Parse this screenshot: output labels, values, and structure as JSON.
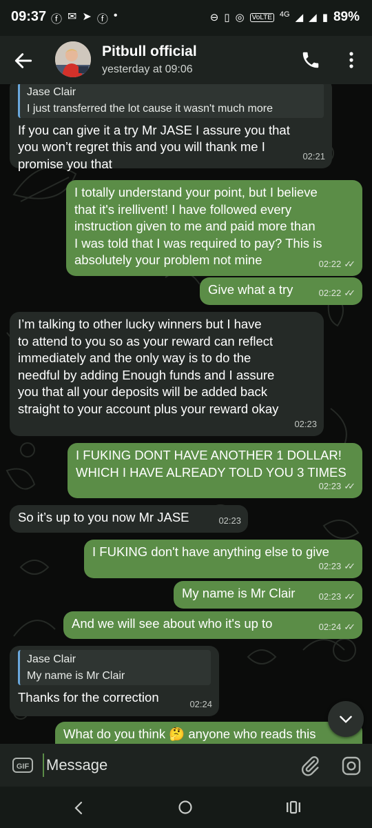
{
  "status_bar": {
    "time": "09:37",
    "network": "4G",
    "volte": "VoLTE",
    "battery": "89%"
  },
  "header": {
    "title": "Pitbull official",
    "subtitle": "yesterday at 09:06"
  },
  "messages": [
    {
      "direction": "incoming",
      "reply_name": "Jase Clair",
      "reply_text": "I just transferred the lot cause it wasn't much more",
      "text": "If you can give it a try Mr JASE I assure you that\nyou won’t regret this and you will thank me I\npromise you that",
      "time": "02:21"
    },
    {
      "direction": "outgoing",
      "text": "I totally understand your point, but I believe\nthat it's irellivent! I have followed every\ninstruction given to me and paid more than\nI was told that I was required to pay? This is\nabsolutely your problem not mine",
      "time": "02:22"
    },
    {
      "direction": "outgoing",
      "text": "Give what a try",
      "time": "02:22"
    },
    {
      "direction": "incoming",
      "text": "I’m talking to other lucky winners but I have\nto attend to you so as your reward can reflect\nimmediately and the only way is to do the\nneedful by adding Enough funds and I assure\nyou that all your deposits will be added back\nstraight to your account plus your reward okay",
      "time": "02:23"
    },
    {
      "direction": "outgoing",
      "text": "I FUKING DONT HAVE ANOTHER 1 DOLLAR!\nWHICH I HAVE ALREADY TOLD YOU 3 TIMES",
      "time": "02:23"
    },
    {
      "direction": "incoming",
      "text": "So it’s up to you now Mr JASE",
      "time": "02:23"
    },
    {
      "direction": "outgoing",
      "text": "I FUKING don't have anything else to give",
      "time": "02:23"
    },
    {
      "direction": "outgoing",
      "text": "My name is Mr Clair",
      "time": "02:23"
    },
    {
      "direction": "outgoing",
      "text": "And we will see about who it's up to",
      "time": "02:24"
    },
    {
      "direction": "incoming",
      "reply_name": "Jase Clair",
      "reply_text": "My name is Mr Clair",
      "text": "Thanks for the correction",
      "time": "02:24"
    },
    {
      "direction": "outgoing",
      "text": "What do you think 🤔 anyone who reads this"
    }
  ],
  "composer": {
    "gif_label": "GIF",
    "placeholder": "Message"
  },
  "colors": {
    "incoming_bubble": "#252a27",
    "outgoing_bubble": "#5b8d47",
    "reply_accent": "#6aa8dc",
    "background": "#0b0c0b"
  },
  "icons": [
    "back-arrow-icon",
    "phone-icon",
    "more-vert-icon",
    "chevron-down-icon",
    "paperclip-icon",
    "camera-icon",
    "nav-back-icon",
    "nav-home-icon",
    "nav-recents-icon"
  ]
}
